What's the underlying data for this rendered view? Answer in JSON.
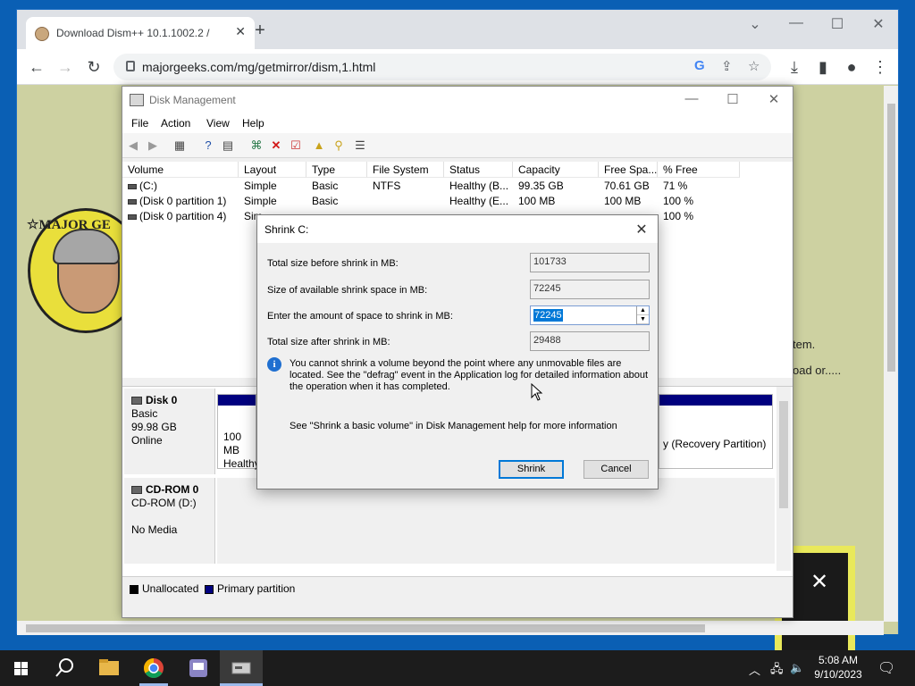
{
  "browser": {
    "tab_title": "Download Dism++ 10.1.1002.2 /",
    "tab_close": "✕",
    "new_tab": "+",
    "url": "majorgeeks.com/mg/getmirror/dism,1.html"
  },
  "page": {
    "logo_text": "☆MAJOR GE",
    "text1": "tem.",
    "text2": "oad or....."
  },
  "disk_mgmt": {
    "title": "Disk Management",
    "menu": [
      "File",
      "Action",
      "View",
      "Help"
    ],
    "columns": [
      "Volume",
      "Layout",
      "Type",
      "File System",
      "Status",
      "Capacity",
      "Free Spa...",
      "% Free"
    ],
    "volumes": [
      {
        "volume": "(C:)",
        "layout": "Simple",
        "type": "Basic",
        "fs": "NTFS",
        "status": "Healthy (B...",
        "capacity": "99.35 GB",
        "free": "70.61 GB",
        "pct": "71 %"
      },
      {
        "volume": "(Disk 0 partition 1)",
        "layout": "Simple",
        "type": "Basic",
        "fs": "",
        "status": "Healthy (E...",
        "capacity": "100 MB",
        "free": "100 MB",
        "pct": "100 %"
      },
      {
        "volume": "(Disk 0 partition 4)",
        "layout": "Sim",
        "type": "",
        "fs": "",
        "status": "",
        "capacity": "",
        "free": "",
        "pct": "100 %"
      }
    ],
    "disk0": {
      "name": "Disk 0",
      "type": "Basic",
      "size": "99.98 GB",
      "status": "Online"
    },
    "disk0_part_text1": "100 MB",
    "disk0_part_text2": "Healthy",
    "disk0_recovery": "y (Recovery Partition)",
    "cdrom": {
      "name": "CD-ROM 0",
      "drive": "CD-ROM (D:)",
      "media": "No Media"
    },
    "legend": [
      {
        "label": "Unallocated",
        "color": "#000000"
      },
      {
        "label": "Primary partition",
        "color": "#00007f"
      }
    ]
  },
  "shrink": {
    "title": "Shrink C:",
    "total_before_label": "Total size before shrink in MB:",
    "total_before_value": "101733",
    "available_label": "Size of available shrink space in MB:",
    "available_value": "72245",
    "amount_label": "Enter the amount of space to shrink in MB:",
    "amount_value": "72245",
    "total_after_label": "Total size after shrink in MB:",
    "total_after_value": "29488",
    "info": "You cannot shrink a volume beyond the point where any unmovable files are located. See the \"defrag\" event in the Application log for detailed information about the operation when it has completed.",
    "help": "See \"Shrink a basic volume\" in Disk Management help for more information",
    "shrink_button": "Shrink",
    "cancel_button": "Cancel"
  },
  "taskbar": {
    "time": "5:08 AM",
    "date": "9/10/2023"
  }
}
